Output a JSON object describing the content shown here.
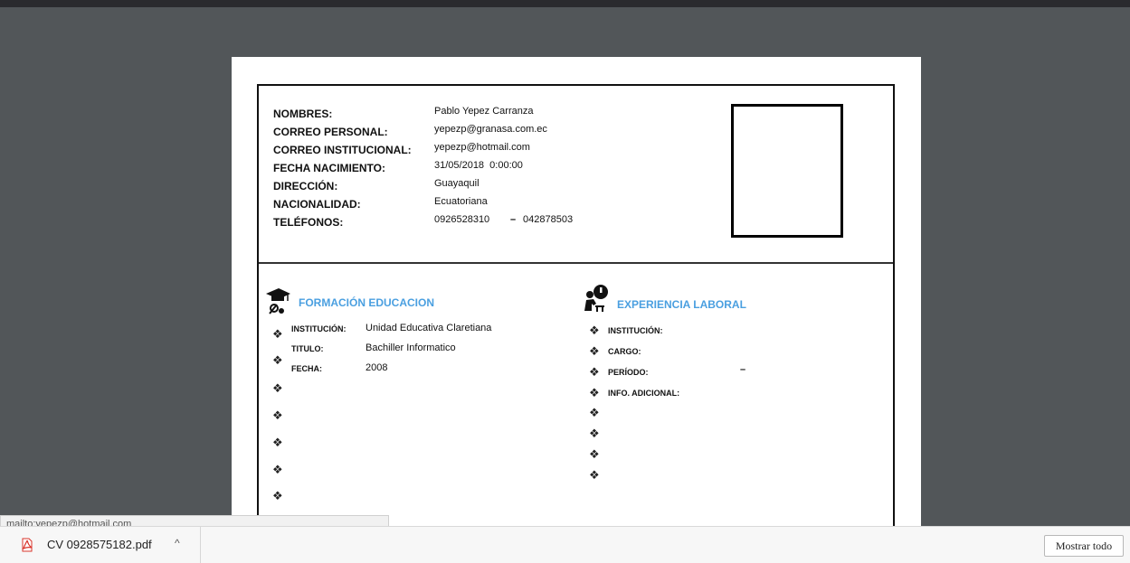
{
  "personal": {
    "rows": [
      {
        "label": "NOMBRES:",
        "value": "Pablo Yepez Carranza"
      },
      {
        "label": "CORREO PERSONAL:",
        "value": "yepezp@granasa.com.ec"
      },
      {
        "label": "CORREO INSTITUCIONAL:",
        "value": "yepezp@hotmail.com"
      },
      {
        "label": "FECHA NACIMIENTO:",
        "value": "31/05/2018  0:00:00"
      },
      {
        "label": "DIRECCIÓN:",
        "value": "Guayaquil"
      },
      {
        "label": "NACIONALIDAD:",
        "value": "Ecuatoriana"
      },
      {
        "label": "TELÉFONOS:",
        "value": "0926528310",
        "dash": "–",
        "value2": "042878503"
      }
    ]
  },
  "education": {
    "title": "FORMACIÓN EDUCACION",
    "fields": [
      {
        "label": "INSTITUCIÓN:",
        "value": "Unidad Educativa Claretiana"
      },
      {
        "label": "TITULO:",
        "value": "Bachiller Informatico"
      },
      {
        "label": "FECHA:",
        "value": "2008"
      }
    ]
  },
  "experience": {
    "title": "EXPERIENCIA LABORAL",
    "fields": [
      {
        "label": "INSTITUCIÓN:",
        "value": ""
      },
      {
        "label": "CARGO:",
        "value": ""
      },
      {
        "label": "PERÍODO:",
        "value": "–"
      },
      {
        "label": "INFO. ADICIONAL:",
        "value": ""
      }
    ]
  },
  "bullet_glyph": "❖",
  "status_url": "mailto:yepezp@hotmail.com",
  "download": {
    "filename": "CV 0928575182.pdf",
    "chevron": "^",
    "show_all_label": "Mostrar todo"
  },
  "icons": {
    "education": "graduation-cap-icon",
    "experience": "worker-clock-icon",
    "pdf": "pdf-file-icon",
    "chevron": "chevron-up-icon"
  },
  "colors": {
    "viewer_bg": "#525659",
    "section_heading": "#4a9fe0",
    "pdf_red": "#d9342b"
  }
}
